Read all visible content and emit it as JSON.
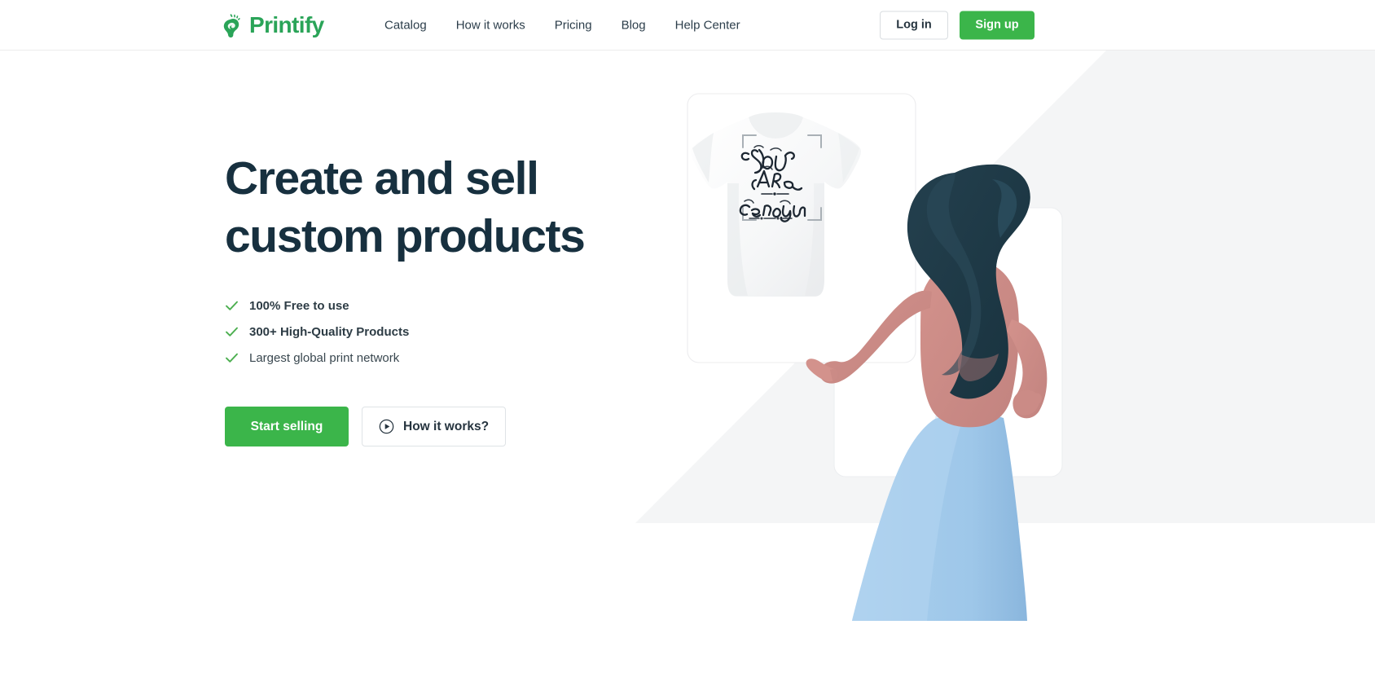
{
  "brand": {
    "name": "Printify",
    "logo_icon": "printify-hand-logo-icon",
    "green": "#3bb54a",
    "logo_green": "#2aa458"
  },
  "header": {
    "nav": [
      {
        "label": "Catalog",
        "name": "catalog"
      },
      {
        "label": "How it works",
        "name": "how-it-works"
      },
      {
        "label": "Pricing",
        "name": "pricing"
      },
      {
        "label": "Blog",
        "name": "blog"
      },
      {
        "label": "Help Center",
        "name": "help-center"
      }
    ],
    "login_label": "Log in",
    "signup_label": "Sign up"
  },
  "hero": {
    "title_line1": "Create and sell",
    "title_line2": "custom products",
    "title_color": "#17303f",
    "features": [
      {
        "text": "100% Free to use",
        "icon": "check-icon",
        "bold": true
      },
      {
        "text": "300+ High-Quality Products",
        "icon": "check-icon",
        "bold": true
      },
      {
        "text": "Largest global print network",
        "icon": "check-icon",
        "bold": false
      }
    ],
    "primary_cta": "Start selling",
    "secondary_cta": "How it works?",
    "secondary_cta_icon": "play-circle-icon"
  },
  "illustration": {
    "name": "woman-pointing-at-tshirt-illustration",
    "tshirt_print_text": "You Are Enough",
    "background_shape_color": "#f4f5f6",
    "card_color": "#ffffff",
    "hair_color": "#1f3c49",
    "skin_color": "#cc8c87",
    "dress_color": "#a3cbeb",
    "dress_shadow_color": "#8fb9dd",
    "tshirt_color": "#f7f8f9"
  }
}
